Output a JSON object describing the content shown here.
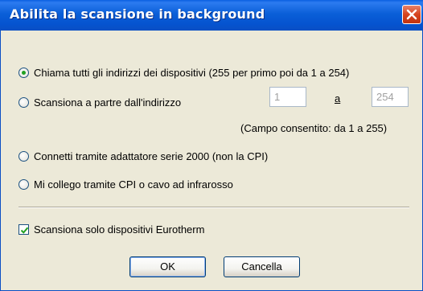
{
  "window": {
    "title": "Abilita la scansione in background"
  },
  "options": {
    "poll_all": "Chiama tutti gli indirizzi dei dispositivi (255 per primo poi da 1 a 254)",
    "scan_from": "Scansiona a partre dall'indirizzo",
    "scan_to": "a",
    "range_note": "(Campo consentito: da 1 a 255)",
    "serial_adapter": "Connetti tramite adattatore serie 2000 (non la CPI)",
    "cpi_infrared": "Mi collego tramite CPI o cavo ad infrarosso"
  },
  "fields": {
    "from_value": "1",
    "to_value": "254"
  },
  "checkbox": {
    "eurotherm_only": "Scansiona solo dispositivi Eurotherm",
    "checked": true
  },
  "buttons": {
    "ok": "OK",
    "cancel": "Cancella"
  },
  "selected_option": "poll_all"
}
